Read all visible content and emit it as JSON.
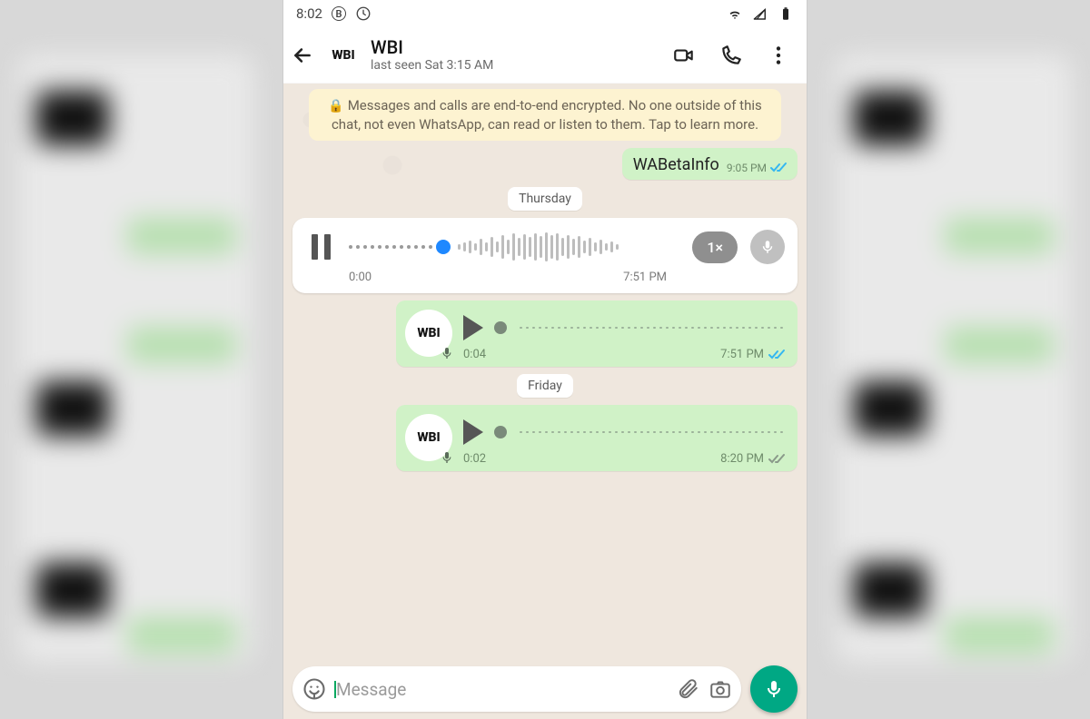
{
  "statusbar": {
    "time": "8:02"
  },
  "header": {
    "avatar_text": "WBI",
    "name": "WBI",
    "last_seen": "last seen Sat 3:15 AM"
  },
  "encryption_notice": "Messages and calls are end-to-end encrypted. No one outside of this chat, not even WhatsApp, can read or listen to them. Tap to learn more.",
  "messages": {
    "text1": {
      "body": "WABetaInfo",
      "time": "9:05 PM"
    },
    "date1": "Thursday",
    "player": {
      "elapsed": "0:00",
      "end_time": "7:51 PM",
      "speed": "1×"
    },
    "voice1": {
      "duration": "0:04",
      "time": "7:51 PM",
      "avatar": "WBI"
    },
    "date2": "Friday",
    "voice2": {
      "duration": "0:02",
      "time": "8:20 PM",
      "avatar": "WBI"
    }
  },
  "input": {
    "placeholder": "Message"
  }
}
